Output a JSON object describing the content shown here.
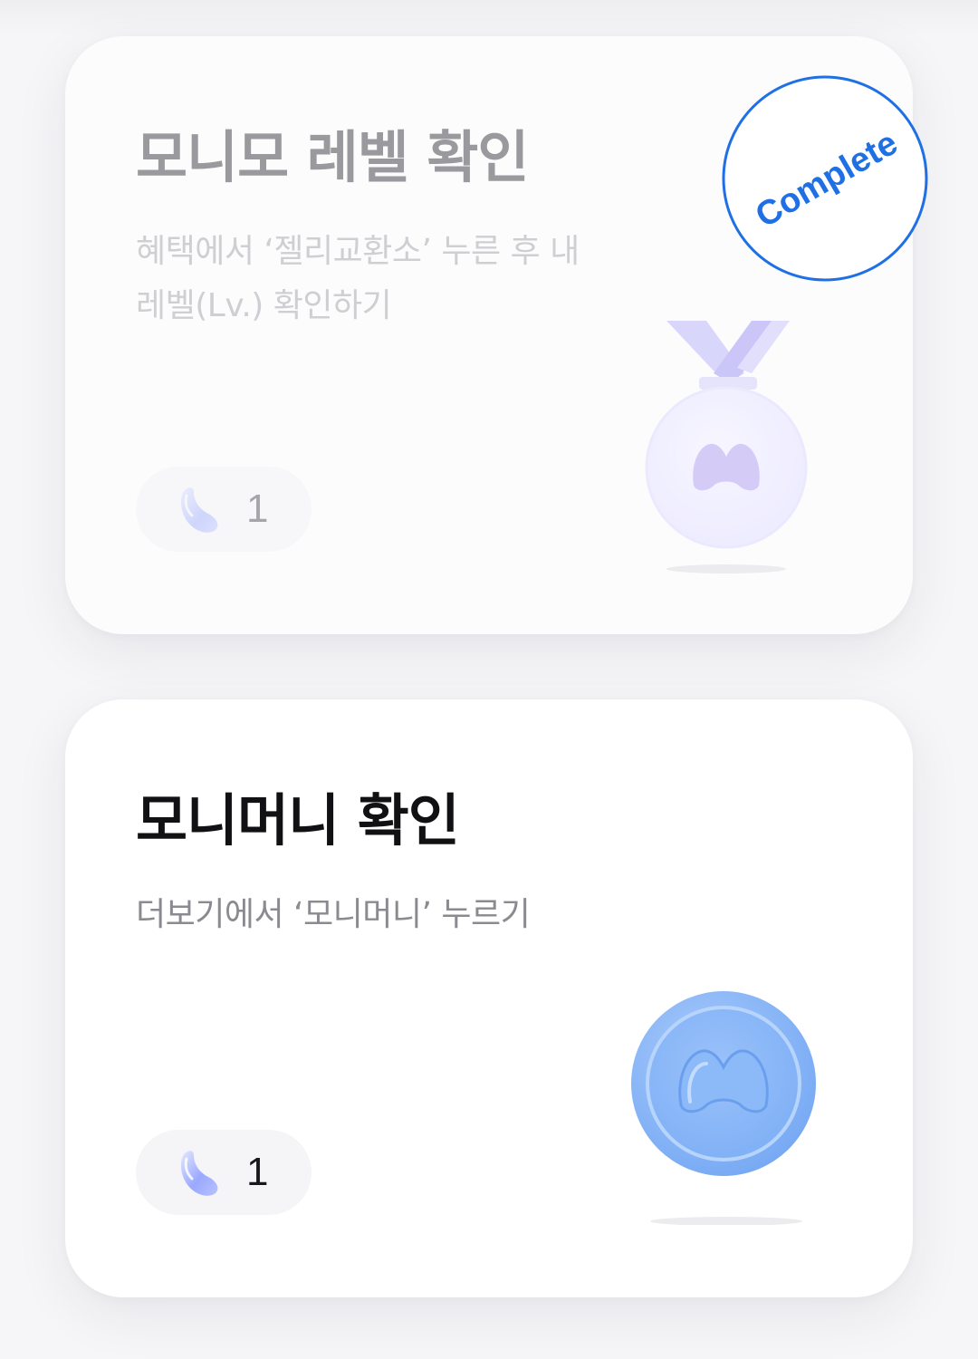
{
  "missions": [
    {
      "title": "모니모 레벨 확인",
      "description": "혜택에서 ‘젤리교환소’ 누른 후 내 레벨(Lv.) 확인하기",
      "reward_count": "1",
      "reward_icon": "jelly-icon",
      "image_icon": "medal-icon",
      "status": "Complete",
      "completed": true
    },
    {
      "title": "모니머니 확인",
      "description": "더보기에서 ‘모니머니’ 누르기",
      "reward_count": "1",
      "reward_icon": "jelly-icon",
      "image_icon": "coin-icon",
      "completed": false
    }
  ],
  "colors": {
    "stamp": "#1f6fe5",
    "coin": "#7fb0f5",
    "medal": "#d6d2fb",
    "jelly": "#a9b9ff"
  }
}
